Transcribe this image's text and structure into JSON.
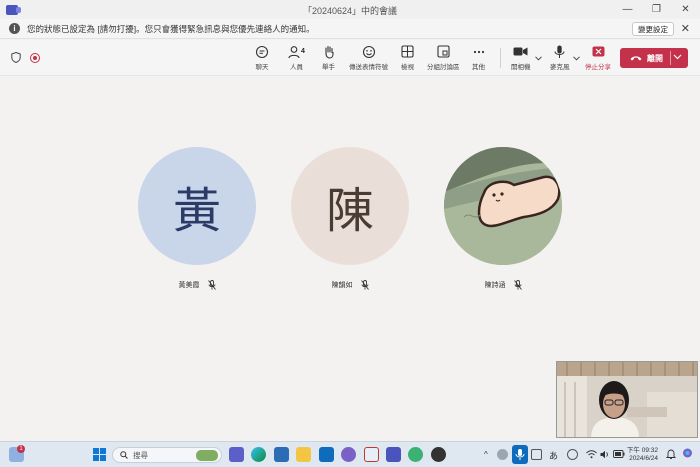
{
  "window": {
    "title": "「20240624」中的會議",
    "minimize": "—",
    "restore": "❐",
    "close": "✕"
  },
  "notice": {
    "message": "您的狀態已設定為 [請勿打擾]。您只會獲得緊急訊息與您優先連絡人的通知。",
    "change_label": "變更設定",
    "close": "✕"
  },
  "toolbar": {
    "chat": "聊天",
    "people": "人員",
    "people_count": "4",
    "raise_hand": "舉手",
    "reactions": "傳送表情符號",
    "view": "檢視",
    "rooms": "分組討論區",
    "more": "其他",
    "camera": "開相機",
    "mic": "麥克風",
    "stop_share": "停止分享",
    "leave": "離開"
  },
  "participants": [
    {
      "initial": "黃",
      "name": "黃美霞",
      "bg": "#c9d5e8",
      "color": "#2b3a67"
    },
    {
      "initial": "陳",
      "name": "陳韻如",
      "bg": "#eaded8",
      "color": "#4a3b33"
    },
    {
      "initial": "",
      "name": "陳詩涵",
      "bg": "#a9b79a",
      "color": "#333333"
    }
  ],
  "taskbar": {
    "search_placeholder": "搜尋",
    "notification_count": "1",
    "time": "下午 09:32",
    "date": "2024/6/24",
    "ime": "あ"
  },
  "colors": {
    "accent": "#c4314b",
    "taskbar": "#dfe7f1"
  }
}
